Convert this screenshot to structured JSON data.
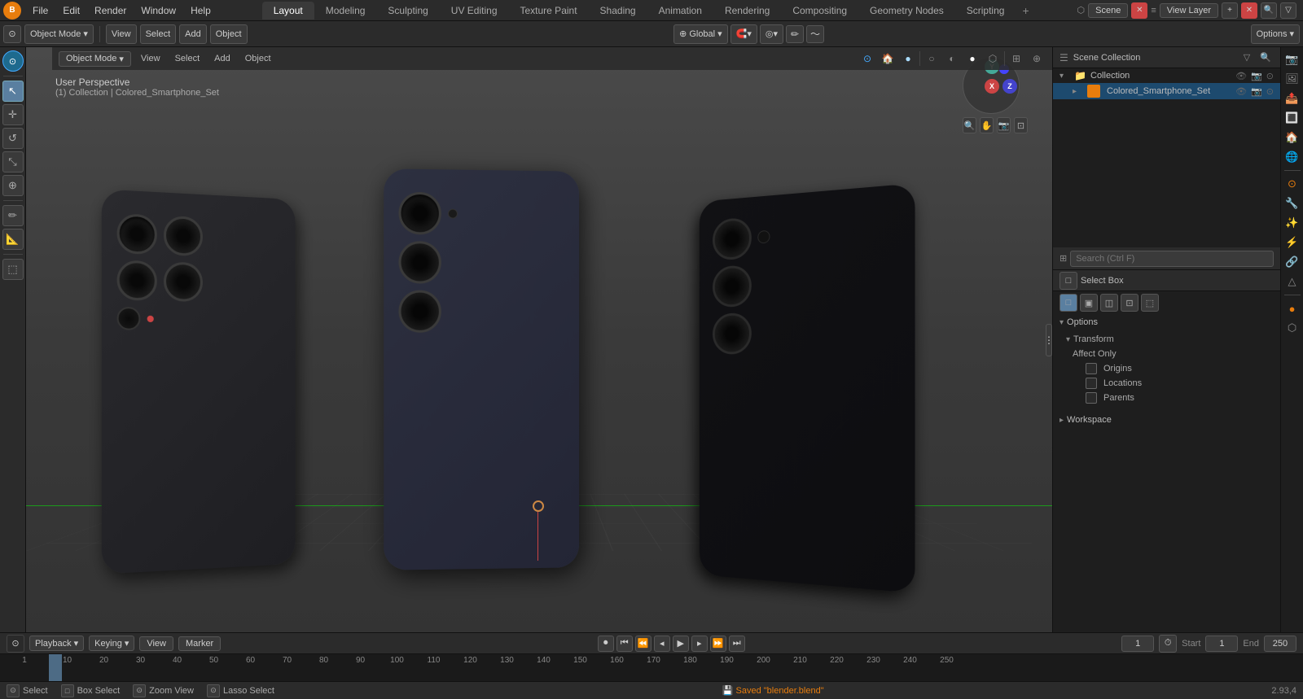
{
  "topMenu": {
    "menuItems": [
      "File",
      "Edit",
      "Render",
      "Window",
      "Help"
    ],
    "workspaceTabs": [
      "Layout",
      "Modeling",
      "Sculpting",
      "UV Editing",
      "Texture Paint",
      "Shading",
      "Animation",
      "Rendering",
      "Compositing",
      "Geometry Nodes",
      "Scripting"
    ],
    "activeTab": "Layout",
    "addTabLabel": "+",
    "scene": "Scene",
    "viewLayer": "View Layer"
  },
  "toolbar": {
    "modeLabel": "Object Mode",
    "viewLabel": "View",
    "selectLabel": "Select",
    "addLabel": "Add",
    "objectLabel": "Object",
    "transformSystem": "Global",
    "optionsLabel": "Options"
  },
  "viewport": {
    "perspLabel": "User Perspective",
    "collectionLabel": "(1) Collection | Colored_Smartphone_Set",
    "gizmo": {
      "xLabel": "X",
      "yLabel": "Y",
      "zLabel": "Z"
    }
  },
  "outliner": {
    "title": "Scene Collection",
    "items": [
      {
        "label": "Collection",
        "icon": "📁",
        "indent": 0
      },
      {
        "label": "Colored_Smartphone_Set",
        "icon": "▷",
        "indent": 1
      }
    ]
  },
  "toolOptions": {
    "title": "Select Box",
    "icons": [
      "□",
      "▣",
      "◫",
      "⊡",
      "⬚"
    ],
    "sections": {
      "options": {
        "label": "Options",
        "subsections": {
          "transform": {
            "label": "Transform",
            "affectOnly": {
              "label": "Affect Only",
              "origins": "Origins",
              "locations": "Locations",
              "parents": "Parents"
            }
          }
        }
      },
      "workspace": {
        "label": "Workspace"
      }
    }
  },
  "timeline": {
    "playbackLabel": "Playback",
    "keyingLabel": "Keying",
    "viewLabel": "View",
    "markerLabel": "Marker",
    "startLabel": "Start",
    "endLabel": "End",
    "startValue": "1",
    "endValue": "250",
    "currentFrame": "1",
    "ticks": [
      "1",
      "10",
      "20",
      "30",
      "40",
      "50",
      "60",
      "70",
      "80",
      "90",
      "100",
      "110",
      "120",
      "130",
      "140",
      "150",
      "160",
      "170",
      "180",
      "190",
      "200",
      "210",
      "220",
      "230",
      "240",
      "250"
    ]
  },
  "statusBar": {
    "select": "Select",
    "boxSelect": "Box Select",
    "zoomView": "Zoom View",
    "lassoSelect": "Lasso Select",
    "savedMessage": "Saved \"blender.blend\"",
    "coords": "2.93,4"
  },
  "icons": {
    "cursor": "⊕",
    "move": "✛",
    "rotate": "↺",
    "scale": "⤡",
    "transform": "⊞",
    "annotate": "✏",
    "measure": "📏",
    "addObject": "🔲",
    "search": "🔍",
    "eye": "👁",
    "camera": "📷",
    "render": "🎨",
    "grid": "⊞",
    "sphere": "○",
    "mat": "●"
  },
  "colors": {
    "accent": "#e87d0d",
    "active": "#5a7fa0",
    "border": "#444",
    "bg_dark": "#1e1e1e",
    "bg_mid": "#2b2b2b",
    "bg_panel": "#232323"
  }
}
